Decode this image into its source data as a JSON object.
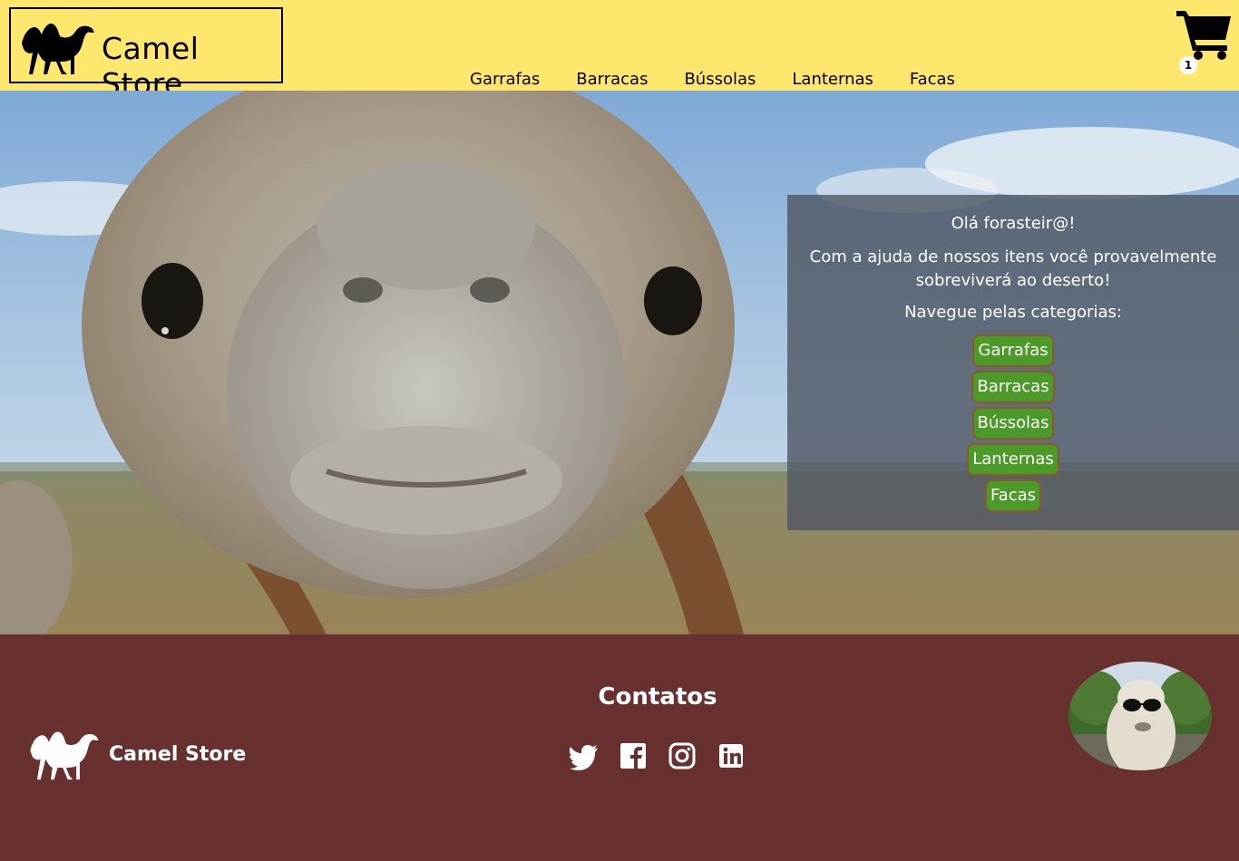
{
  "header": {
    "brand": "Camel Store",
    "nav": [
      "Garrafas",
      "Barracas",
      "Bússolas",
      "Lanternas",
      "Facas"
    ],
    "cart_count": "1"
  },
  "hero": {
    "greeting": "Olá forasteir@!",
    "message": "Com a ajuda de nossos itens você provavelmente sobreviverá ao deserto!",
    "browse_label": "Navegue pelas categorias:",
    "categories": [
      "Garrafas",
      "Barracas",
      "Bússolas",
      "Lanternas",
      "Facas"
    ]
  },
  "footer": {
    "brand": "Camel Store",
    "contacts_title": "Contatos",
    "socials": [
      "twitter-icon",
      "facebook-icon",
      "instagram-icon",
      "linkedin-icon"
    ]
  },
  "colors": {
    "header_bg": "#ffe66d",
    "footer_bg": "#683130",
    "category_button": "#4c9a2a"
  }
}
